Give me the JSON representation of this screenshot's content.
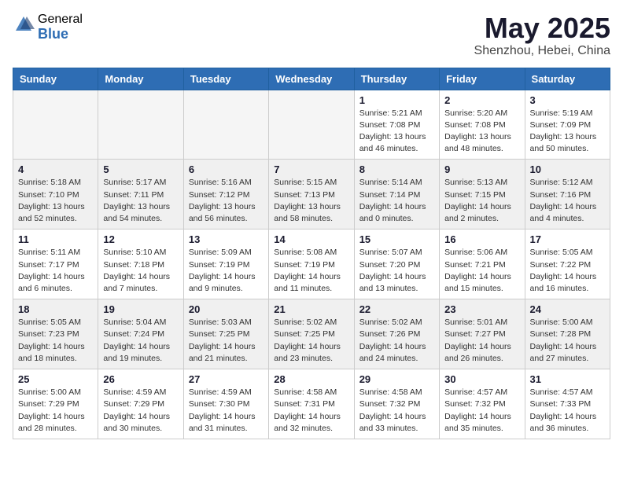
{
  "logo": {
    "general": "General",
    "blue": "Blue"
  },
  "title": {
    "month_year": "May 2025",
    "location": "Shenzhou, Hebei, China"
  },
  "weekdays": [
    "Sunday",
    "Monday",
    "Tuesday",
    "Wednesday",
    "Thursday",
    "Friday",
    "Saturday"
  ],
  "weeks": [
    [
      {
        "day": "",
        "info": ""
      },
      {
        "day": "",
        "info": ""
      },
      {
        "day": "",
        "info": ""
      },
      {
        "day": "",
        "info": ""
      },
      {
        "day": "1",
        "info": "Sunrise: 5:21 AM\nSunset: 7:08 PM\nDaylight: 13 hours\nand 46 minutes."
      },
      {
        "day": "2",
        "info": "Sunrise: 5:20 AM\nSunset: 7:08 PM\nDaylight: 13 hours\nand 48 minutes."
      },
      {
        "day": "3",
        "info": "Sunrise: 5:19 AM\nSunset: 7:09 PM\nDaylight: 13 hours\nand 50 minutes."
      }
    ],
    [
      {
        "day": "4",
        "info": "Sunrise: 5:18 AM\nSunset: 7:10 PM\nDaylight: 13 hours\nand 52 minutes."
      },
      {
        "day": "5",
        "info": "Sunrise: 5:17 AM\nSunset: 7:11 PM\nDaylight: 13 hours\nand 54 minutes."
      },
      {
        "day": "6",
        "info": "Sunrise: 5:16 AM\nSunset: 7:12 PM\nDaylight: 13 hours\nand 56 minutes."
      },
      {
        "day": "7",
        "info": "Sunrise: 5:15 AM\nSunset: 7:13 PM\nDaylight: 13 hours\nand 58 minutes."
      },
      {
        "day": "8",
        "info": "Sunrise: 5:14 AM\nSunset: 7:14 PM\nDaylight: 14 hours\nand 0 minutes."
      },
      {
        "day": "9",
        "info": "Sunrise: 5:13 AM\nSunset: 7:15 PM\nDaylight: 14 hours\nand 2 minutes."
      },
      {
        "day": "10",
        "info": "Sunrise: 5:12 AM\nSunset: 7:16 PM\nDaylight: 14 hours\nand 4 minutes."
      }
    ],
    [
      {
        "day": "11",
        "info": "Sunrise: 5:11 AM\nSunset: 7:17 PM\nDaylight: 14 hours\nand 6 minutes."
      },
      {
        "day": "12",
        "info": "Sunrise: 5:10 AM\nSunset: 7:18 PM\nDaylight: 14 hours\nand 7 minutes."
      },
      {
        "day": "13",
        "info": "Sunrise: 5:09 AM\nSunset: 7:19 PM\nDaylight: 14 hours\nand 9 minutes."
      },
      {
        "day": "14",
        "info": "Sunrise: 5:08 AM\nSunset: 7:19 PM\nDaylight: 14 hours\nand 11 minutes."
      },
      {
        "day": "15",
        "info": "Sunrise: 5:07 AM\nSunset: 7:20 PM\nDaylight: 14 hours\nand 13 minutes."
      },
      {
        "day": "16",
        "info": "Sunrise: 5:06 AM\nSunset: 7:21 PM\nDaylight: 14 hours\nand 15 minutes."
      },
      {
        "day": "17",
        "info": "Sunrise: 5:05 AM\nSunset: 7:22 PM\nDaylight: 14 hours\nand 16 minutes."
      }
    ],
    [
      {
        "day": "18",
        "info": "Sunrise: 5:05 AM\nSunset: 7:23 PM\nDaylight: 14 hours\nand 18 minutes."
      },
      {
        "day": "19",
        "info": "Sunrise: 5:04 AM\nSunset: 7:24 PM\nDaylight: 14 hours\nand 19 minutes."
      },
      {
        "day": "20",
        "info": "Sunrise: 5:03 AM\nSunset: 7:25 PM\nDaylight: 14 hours\nand 21 minutes."
      },
      {
        "day": "21",
        "info": "Sunrise: 5:02 AM\nSunset: 7:25 PM\nDaylight: 14 hours\nand 23 minutes."
      },
      {
        "day": "22",
        "info": "Sunrise: 5:02 AM\nSunset: 7:26 PM\nDaylight: 14 hours\nand 24 minutes."
      },
      {
        "day": "23",
        "info": "Sunrise: 5:01 AM\nSunset: 7:27 PM\nDaylight: 14 hours\nand 26 minutes."
      },
      {
        "day": "24",
        "info": "Sunrise: 5:00 AM\nSunset: 7:28 PM\nDaylight: 14 hours\nand 27 minutes."
      }
    ],
    [
      {
        "day": "25",
        "info": "Sunrise: 5:00 AM\nSunset: 7:29 PM\nDaylight: 14 hours\nand 28 minutes."
      },
      {
        "day": "26",
        "info": "Sunrise: 4:59 AM\nSunset: 7:29 PM\nDaylight: 14 hours\nand 30 minutes."
      },
      {
        "day": "27",
        "info": "Sunrise: 4:59 AM\nSunset: 7:30 PM\nDaylight: 14 hours\nand 31 minutes."
      },
      {
        "day": "28",
        "info": "Sunrise: 4:58 AM\nSunset: 7:31 PM\nDaylight: 14 hours\nand 32 minutes."
      },
      {
        "day": "29",
        "info": "Sunrise: 4:58 AM\nSunset: 7:32 PM\nDaylight: 14 hours\nand 33 minutes."
      },
      {
        "day": "30",
        "info": "Sunrise: 4:57 AM\nSunset: 7:32 PM\nDaylight: 14 hours\nand 35 minutes."
      },
      {
        "day": "31",
        "info": "Sunrise: 4:57 AM\nSunset: 7:33 PM\nDaylight: 14 hours\nand 36 minutes."
      }
    ]
  ]
}
